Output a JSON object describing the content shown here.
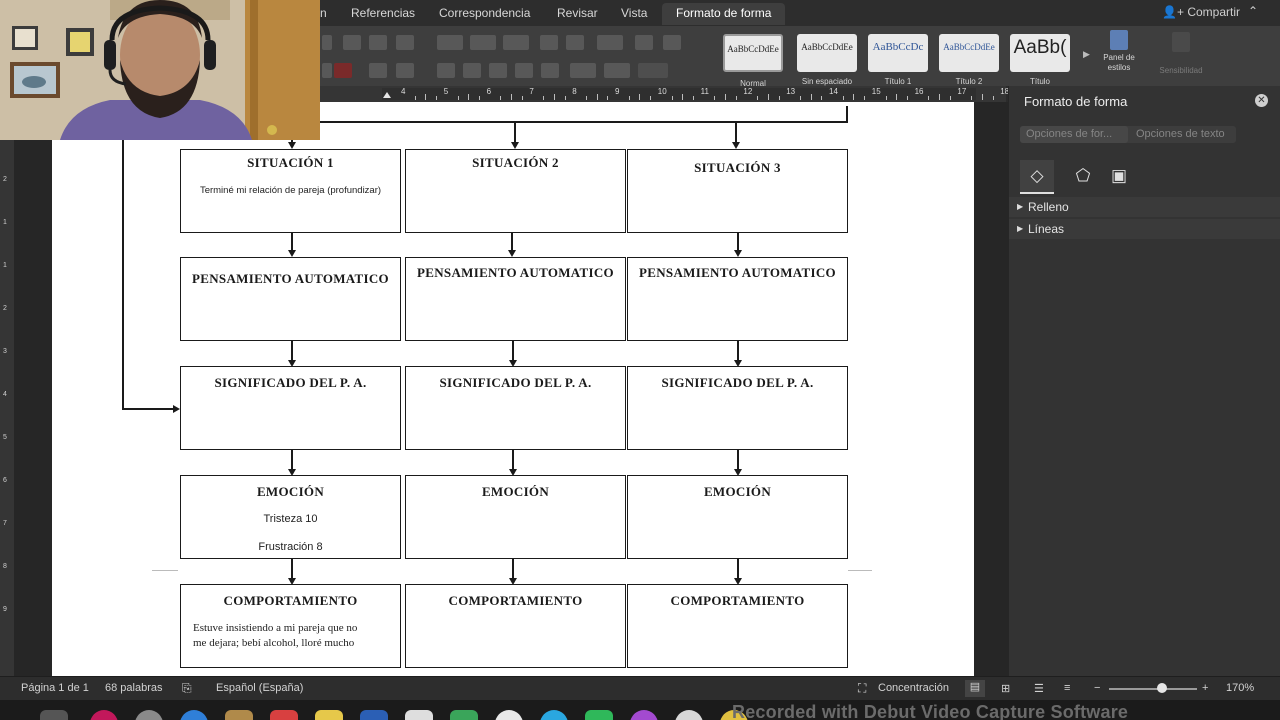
{
  "ribbon": {
    "tabs": [
      {
        "label": "n"
      },
      {
        "label": "Referencias"
      },
      {
        "label": "Correspondencia"
      },
      {
        "label": "Revisar"
      },
      {
        "label": "Vista"
      },
      {
        "label": "Formato de forma"
      }
    ],
    "share_label": "Compartir",
    "styles": [
      {
        "sample": "AaBbCcDdEe",
        "name": "Normal"
      },
      {
        "sample": "AaBbCcDdEe",
        "name": "Sin espaciado"
      },
      {
        "sample": "AaBbCcDc",
        "name": "Título 1"
      },
      {
        "sample": "AaBbCcDdEe",
        "name": "Título 2"
      },
      {
        "sample": "AaBb(",
        "name": "Título"
      }
    ],
    "styles_pane_label": "Panel de estilos",
    "sensitivity_label": "Sensibilidad"
  },
  "ruler": {
    "numbers": [
      "4",
      "5",
      "6",
      "7",
      "8",
      "9",
      "10",
      "11",
      "12",
      "13",
      "14",
      "15",
      "16",
      "17",
      "18"
    ]
  },
  "diagram": {
    "columns": [
      {
        "situation": {
          "title": "SITUACIÓN 1",
          "text": "Terminé mi relación de pareja (profundizar)"
        },
        "thought": {
          "title": "PENSAMIENTO AUTOMATICO"
        },
        "meaning": {
          "title": "SIGNIFICADO DEL P. A."
        },
        "emotion": {
          "title": "EMOCIÓN",
          "line1": "Tristeza 10",
          "line2": "Frustración 8"
        },
        "behavior": {
          "title": "COMPORTAMIENTO",
          "line1": "Estuve insistiendo a mi pareja que no",
          "line2": "me dejara; bebí alcohol, lloré mucho"
        }
      },
      {
        "situation": {
          "title": "SITUACIÓN 2"
        },
        "thought": {
          "title": "PENSAMIENTO AUTOMATICO"
        },
        "meaning": {
          "title": "SIGNIFICADO DEL P. A."
        },
        "emotion": {
          "title": "EMOCIÓN"
        },
        "behavior": {
          "title": "COMPORTAMIENTO"
        }
      },
      {
        "situation": {
          "title": "SITUACIÓN 3"
        },
        "thought": {
          "title": "PENSAMIENTO AUTOMATICO"
        },
        "meaning": {
          "title": "SIGNIFICADO DEL P. A."
        },
        "emotion": {
          "title": "EMOCIÓN"
        },
        "behavior": {
          "title": "COMPORTAMIENTO"
        }
      }
    ]
  },
  "pane": {
    "title": "Formato de forma",
    "tabs": [
      "Opciones de for...",
      "Opciones de texto"
    ],
    "sections": [
      {
        "label": "Relleno"
      },
      {
        "label": "Líneas"
      }
    ]
  },
  "status": {
    "page": "Página 1 de 1",
    "words": "68 palabras",
    "language": "Español (España)",
    "focus": "Concentración",
    "zoom": "170%",
    "zoom_fraction": 0.6
  },
  "dock": {
    "recorded_text": "Recorded with Debut Video Capture Software"
  },
  "colors": {
    "ribbon_bg": "#3e3e3e",
    "pane_bg": "#333333",
    "page": "#ffffff",
    "accent_red": "#e83a3a"
  }
}
